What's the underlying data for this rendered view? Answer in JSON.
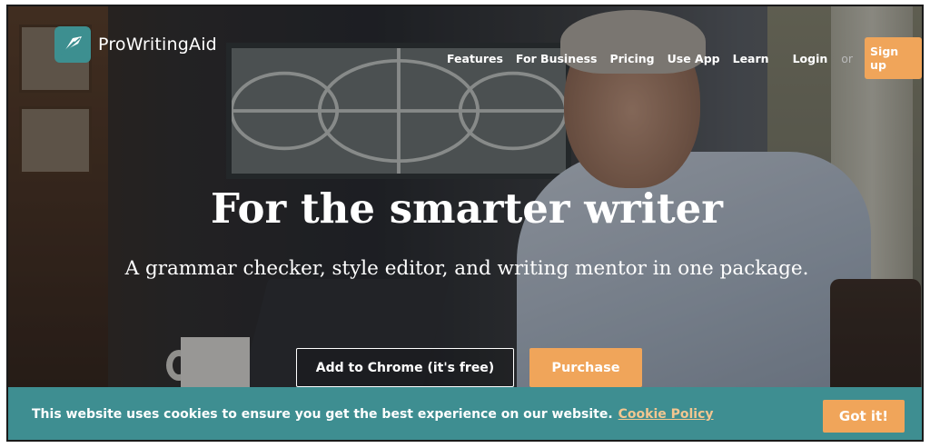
{
  "brand": {
    "name": "ProWritingAid",
    "icon": "feather-icon",
    "color": "#3d8f90"
  },
  "nav": {
    "items": [
      {
        "label": "Features"
      },
      {
        "label": "For Business"
      },
      {
        "label": "Pricing"
      },
      {
        "label": "Use App"
      },
      {
        "label": "Learn"
      }
    ],
    "login_label": "Login",
    "or_label": "or",
    "signup_label": "Sign up"
  },
  "hero": {
    "title": "For the smarter writer",
    "subtitle": "A grammar checker, style editor, and writing mentor in one package.",
    "chrome_button": "Add to Chrome (it's free)",
    "purchase_button": "Purchase"
  },
  "cookie_banner": {
    "message": "This website uses cookies to ensure you get the best experience on our website.",
    "link_label": "Cookie Policy",
    "accept_label": "Got it!"
  },
  "colors": {
    "accent": "#f0a55a",
    "banner": "#3e8e91",
    "link": "#f3c690"
  }
}
